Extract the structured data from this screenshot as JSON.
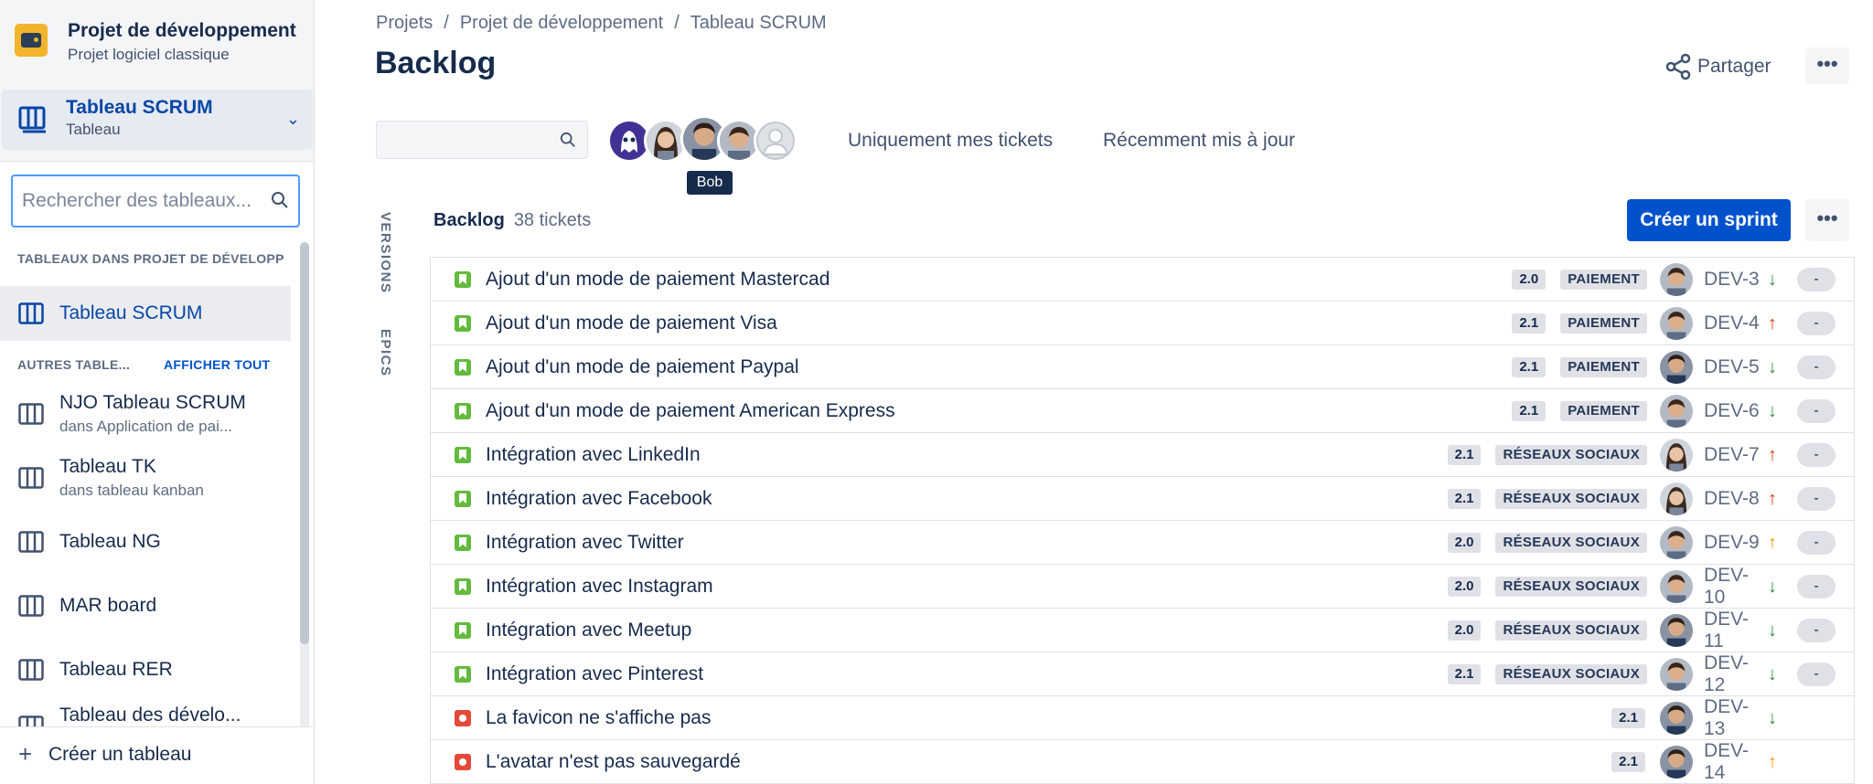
{
  "project": {
    "name": "Projet de développement",
    "subtitle": "Projet logiciel classique"
  },
  "board_selector": {
    "name": "Tableau SCRUM",
    "subtitle": "Tableau"
  },
  "board_search": {
    "placeholder": "Rechercher des tableaux..."
  },
  "sidebar": {
    "section_current": "TABLEAUX DANS PROJET DE DÉVELOPP",
    "current_board": "Tableau SCRUM",
    "section_others": "AUTRES TABLE...",
    "show_all": "AFFICHER TOUT",
    "boards": [
      {
        "name": "NJO Tableau SCRUM",
        "sub": "dans Application de pai..."
      },
      {
        "name": "Tableau TK",
        "sub": "dans tableau kanban"
      },
      {
        "name": "Tableau NG",
        "sub": ""
      },
      {
        "name": "MAR board",
        "sub": ""
      },
      {
        "name": "Tableau RER",
        "sub": ""
      },
      {
        "name": "Tableau des dévelo...",
        "sub": ""
      }
    ],
    "create_board": "Créer un tableau"
  },
  "breadcrumb": [
    "Projets",
    "Projet de développement",
    "Tableau SCRUM"
  ],
  "page_title": "Backlog",
  "share_label": "Partager",
  "more_glyph": "•••",
  "tooltip": "Bob",
  "filters": {
    "mine": "Uniquement mes tickets",
    "recent": "Récemment mis à jour"
  },
  "vertical_tabs": {
    "versions": "VERSIONS",
    "epics": "EPICS"
  },
  "backlog": {
    "title": "Backlog",
    "count": "38 tickets",
    "create_sprint": "Créer un sprint",
    "issues": [
      {
        "type": "story",
        "summary": "Ajout d'un mode de paiement Mastercad",
        "version": "2.0",
        "epic": "PAIEMENT",
        "key": "DEV-3",
        "priority": "low",
        "estimate": "-"
      },
      {
        "type": "story",
        "summary": "Ajout d'un mode de paiement Visa",
        "version": "2.1",
        "epic": "PAIEMENT",
        "key": "DEV-4",
        "priority": "high",
        "estimate": "-"
      },
      {
        "type": "story",
        "summary": "Ajout d'un mode de paiement Paypal",
        "version": "2.1",
        "epic": "PAIEMENT",
        "key": "DEV-5",
        "priority": "low",
        "estimate": "-"
      },
      {
        "type": "story",
        "summary": "Ajout d'un mode de paiement American Express",
        "version": "2.1",
        "epic": "PAIEMENT",
        "key": "DEV-6",
        "priority": "low",
        "estimate": "-"
      },
      {
        "type": "story",
        "summary": "Intégration avec LinkedIn",
        "version": "2.1",
        "epic": "RÉSEAUX SOCIAUX",
        "key": "DEV-7",
        "priority": "high",
        "estimate": "-"
      },
      {
        "type": "story",
        "summary": "Intégration avec Facebook",
        "version": "2.1",
        "epic": "RÉSEAUX SOCIAUX",
        "key": "DEV-8",
        "priority": "high",
        "estimate": "-"
      },
      {
        "type": "story",
        "summary": "Intégration avec Twitter",
        "version": "2.0",
        "epic": "RÉSEAUX SOCIAUX",
        "key": "DEV-9",
        "priority": "medium",
        "estimate": "-"
      },
      {
        "type": "story",
        "summary": "Intégration avec Instagram",
        "version": "2.0",
        "epic": "RÉSEAUX SOCIAUX",
        "key": "DEV-10",
        "priority": "low",
        "estimate": "-"
      },
      {
        "type": "story",
        "summary": "Intégration avec Meetup",
        "version": "2.0",
        "epic": "RÉSEAUX SOCIAUX",
        "key": "DEV-11",
        "priority": "low",
        "estimate": "-"
      },
      {
        "type": "story",
        "summary": "Intégration avec Pinterest",
        "version": "2.1",
        "epic": "RÉSEAUX SOCIAUX",
        "key": "DEV-12",
        "priority": "low",
        "estimate": "-"
      },
      {
        "type": "bug",
        "summary": "La favicon ne s'affiche pas",
        "version": "2.1",
        "epic": "",
        "key": "DEV-13",
        "priority": "low",
        "estimate": ""
      },
      {
        "type": "bug",
        "summary": "L'avatar n'est pas sauvegardé",
        "version": "2.1",
        "epic": "",
        "key": "DEV-14",
        "priority": "medium",
        "estimate": ""
      }
    ]
  }
}
